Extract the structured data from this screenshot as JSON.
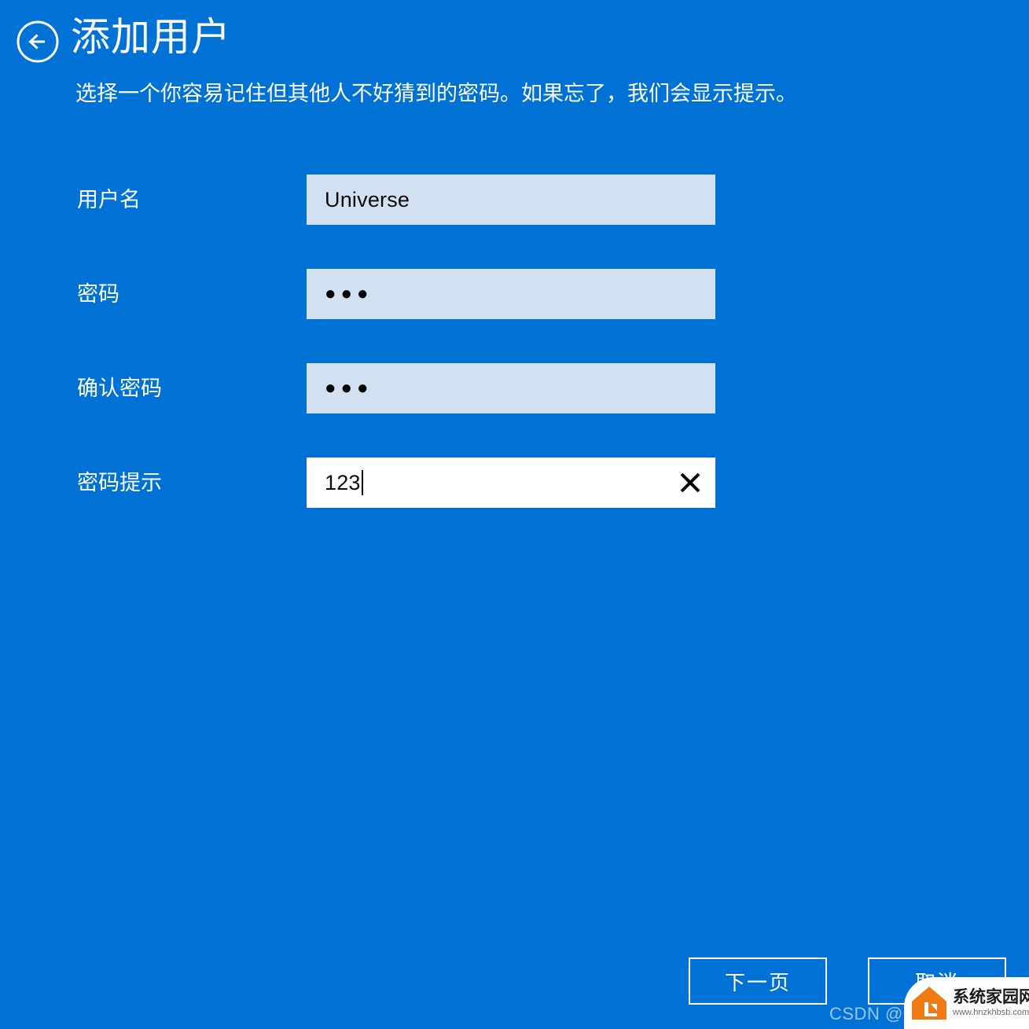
{
  "window": {
    "background_color": "#0072D6",
    "accent_text_color": "#ffffff",
    "input_background": "#d2e1f1",
    "input_focused_background": "#ffffff"
  },
  "header": {
    "back_icon": "back-arrow-circle-icon",
    "title": "添加用户",
    "subtitle": "选择一个你容易记住但其他人不好猜到的密码。如果忘了，我们会显示提示。"
  },
  "form": {
    "fields": [
      {
        "label": "用户名",
        "value": "Universe",
        "type": "text",
        "focused": false,
        "has_clear_button": false,
        "name": "username"
      },
      {
        "label": "密码",
        "value": "●●●",
        "type": "password",
        "focused": false,
        "has_clear_button": false,
        "name": "password"
      },
      {
        "label": "确认密码",
        "value": "●●●",
        "type": "password",
        "focused": false,
        "has_clear_button": false,
        "name": "confirm-password"
      },
      {
        "label": "密码提示",
        "value": "123",
        "type": "text",
        "focused": true,
        "has_clear_button": true,
        "clear_icon": "clear-x-icon",
        "name": "password-hint"
      }
    ]
  },
  "footer": {
    "next_label": "下一页",
    "cancel_label": "取消"
  },
  "watermarks": {
    "csdn": "CSDN @一",
    "site_name": "系统家园网",
    "site_url": "www.hnzkhbsb.com",
    "site_logo_color": "#F07A13"
  }
}
